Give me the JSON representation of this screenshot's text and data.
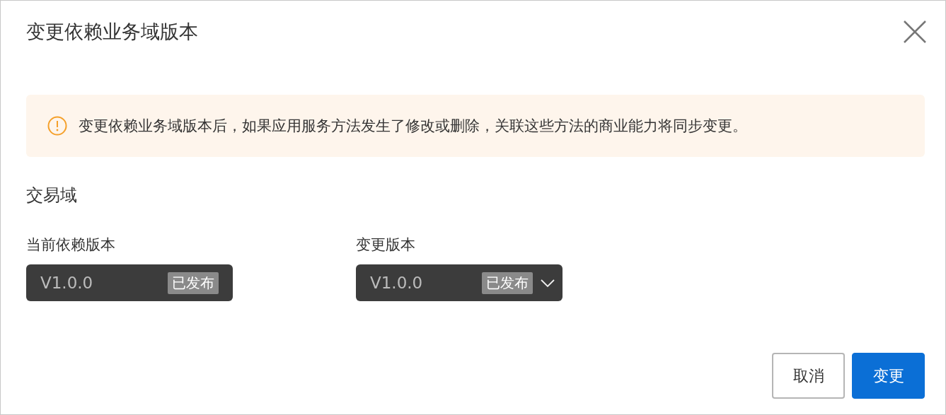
{
  "dialog": {
    "title": "变更依赖业务域版本"
  },
  "alert": {
    "kind": "warning",
    "text": "变更依赖业务域版本后，如果应用服务方法发生了修改或删除，关联这些方法的商业能力将同步变更。"
  },
  "section": {
    "title": "交易域"
  },
  "fields": [
    {
      "label": "当前依赖版本",
      "value": "V1.0.0",
      "tag": "已发布",
      "kind": "static"
    },
    {
      "label": "变更版本",
      "value": "V1.0.0",
      "tag": "已发布",
      "kind": "select"
    }
  ],
  "buttons": [
    {
      "label": "取消",
      "kind": "secondary"
    },
    {
      "label": "变更",
      "kind": "primary"
    }
  ]
}
